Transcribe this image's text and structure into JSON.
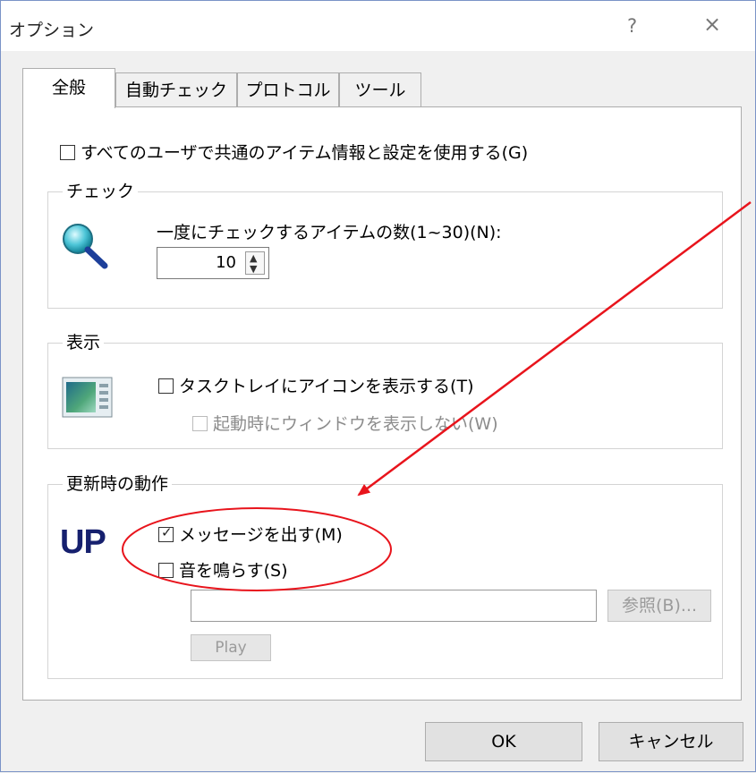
{
  "window": {
    "title": "オプション",
    "help_label": "?",
    "close_label": "×"
  },
  "tabs": [
    {
      "label": "全般",
      "active": true
    },
    {
      "label": "自動チェック",
      "active": false
    },
    {
      "label": "プロトコル",
      "active": false
    },
    {
      "label": "ツール",
      "active": false
    }
  ],
  "general": {
    "shared_settings_label": "すべてのユーザで共通のアイテム情報と設定を使用する(G)",
    "shared_settings_checked": false
  },
  "check_group": {
    "label": "チェック",
    "items_label": "一度にチェックするアイテムの数(1~30)(N):",
    "items_value": "10"
  },
  "display_group": {
    "label": "表示",
    "tray_icon_label": "タスクトレイにアイコンを表示する(T)",
    "tray_icon_checked": false,
    "hide_window_label": "起動時にウィンドウを表示しない(W)",
    "hide_window_checked": false
  },
  "update_group": {
    "label": "更新時の動作",
    "logo_text": "UP",
    "message_label": "メッセージを出す(M)",
    "message_checked": true,
    "sound_label": "音を鳴らす(S)",
    "sound_checked": false,
    "sound_path_value": "",
    "browse_label": "参照(B)...",
    "play_label": "Play"
  },
  "footer": {
    "ok_label": "OK",
    "cancel_label": "キャンセル"
  },
  "annotation": {
    "color": "#e8141c"
  }
}
